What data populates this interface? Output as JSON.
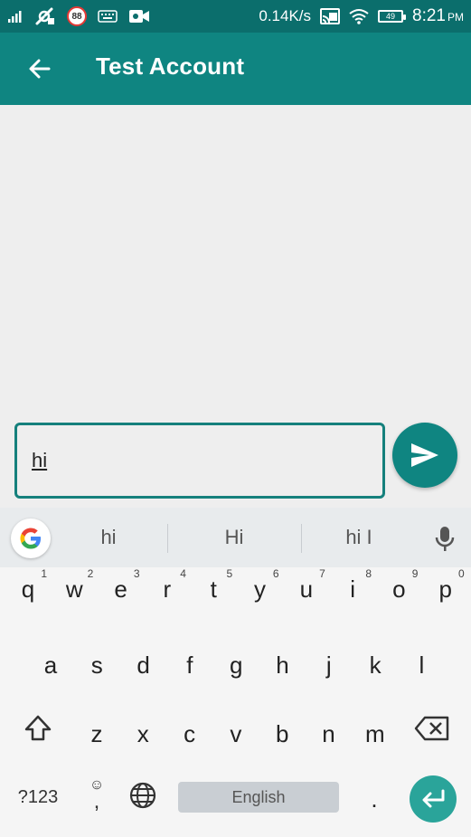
{
  "status_bar": {
    "notif_count": "88",
    "speed": "0.14K/s",
    "battery": "49",
    "time": "8:21",
    "ampm": "PM",
    "icons": [
      "signal-icon",
      "vpn-icon",
      "notification-icon",
      "keyboard-icon",
      "video-icon",
      "cast-icon",
      "wifi-icon",
      "battery-icon"
    ]
  },
  "app_bar": {
    "title": "Test Account",
    "color": "#0f8581"
  },
  "composer": {
    "input_value": "hi"
  },
  "keyboard": {
    "suggestions": [
      "hi",
      "Hi",
      "hi I"
    ],
    "rows": [
      [
        {
          "k": "q",
          "h": "1"
        },
        {
          "k": "w",
          "h": "2"
        },
        {
          "k": "e",
          "h": "3"
        },
        {
          "k": "r",
          "h": "4"
        },
        {
          "k": "t",
          "h": "5"
        },
        {
          "k": "y",
          "h": "6"
        },
        {
          "k": "u",
          "h": "7"
        },
        {
          "k": "i",
          "h": "8"
        },
        {
          "k": "o",
          "h": "9"
        },
        {
          "k": "p",
          "h": "0"
        }
      ],
      [
        {
          "k": "a"
        },
        {
          "k": "s"
        },
        {
          "k": "d"
        },
        {
          "k": "f"
        },
        {
          "k": "g"
        },
        {
          "k": "h"
        },
        {
          "k": "j"
        },
        {
          "k": "k"
        },
        {
          "k": "l"
        }
      ],
      [
        {
          "k": "z"
        },
        {
          "k": "x"
        },
        {
          "k": "c"
        },
        {
          "k": "v"
        },
        {
          "k": "b"
        },
        {
          "k": "n"
        },
        {
          "k": "m"
        }
      ]
    ],
    "num_label": "?123",
    "comma_label": ",",
    "space_label": "English",
    "period_label": "."
  }
}
